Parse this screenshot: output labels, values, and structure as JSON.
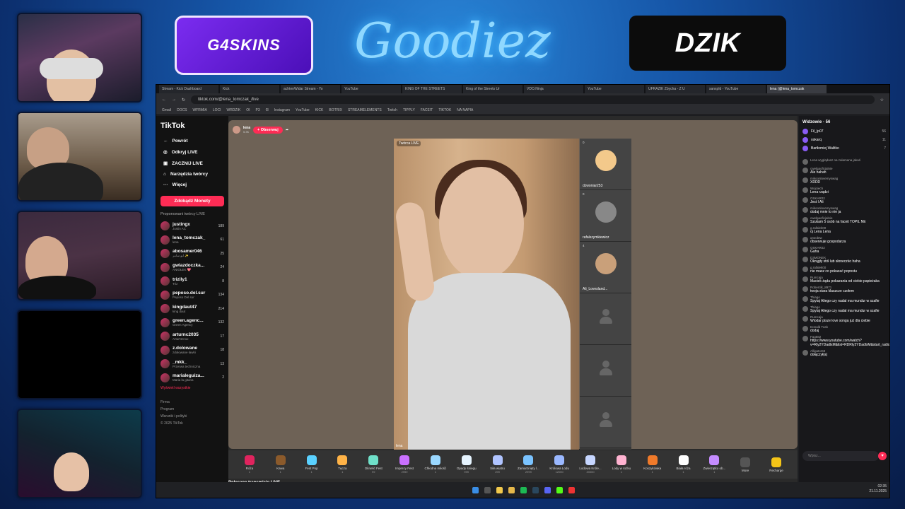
{
  "overlay": {
    "sponsor_left": "G4SKINS",
    "sponsor_center": "Goodiez",
    "sponsor_right": "DZIK"
  },
  "browser": {
    "tabs": [
      "Stream - Kick Dashboard",
      "Kick",
      "achtenWidar Stream - Yo",
      "YouTube",
      "KING OF THE STREETS",
      "King of the Streets Ur",
      "VDO.Ninja",
      "YouTube",
      "UFRAZIK Zbycha - Z U",
      "sanxpld - YouTube",
      "lena (@lena_tomczak"
    ],
    "url": "tiktok.com/@lena_tomczak_/live",
    "bookmarks": [
      "Gmail",
      "DOCS",
      "WFRMIA",
      "LOCI",
      "WRDZIK",
      "OI",
      "P3",
      "f3",
      "Instagram",
      "YouTube",
      "KICK",
      "BOTRIX",
      "STREAMELEMENTS",
      "Twitch",
      "TIPPLY",
      "FACEIT",
      "TIKTOK",
      "NA NAPIA"
    ]
  },
  "tiktok": {
    "logo": "TikTok",
    "nav": [
      {
        "label": "Powrót",
        "icon": "arrow-left-icon"
      },
      {
        "label": "Odkryj LIVE",
        "icon": "compass-icon"
      },
      {
        "label": "ZACZNIJ LIVE",
        "icon": "camera-icon"
      },
      {
        "label": "Narzędzia twórcy",
        "icon": "home-icon"
      },
      {
        "label": "Więcej",
        "icon": "more-icon"
      }
    ],
    "coins_button": "Zdobądź Monety",
    "section_title": "Proponowani twórcy LIVE",
    "creators": [
      {
        "name": "justingx",
        "sub": "Justin AC",
        "viewers": "189"
      },
      {
        "name": "lena_tomczak_",
        "sub": "lena",
        "viewers": "61"
      },
      {
        "name": "abosamer046",
        "sub": "ابو سامر ✨",
        "viewers": "25"
      },
      {
        "name": "gwiazdoczka...",
        "sub": "ANIOŁEK 💖",
        "viewers": "24"
      },
      {
        "name": "trizily1",
        "sub": "Triz",
        "viewers": "8"
      },
      {
        "name": "peposo.del.sur",
        "sub": "Peposo Del sur",
        "viewers": "134"
      },
      {
        "name": "kingdaut47",
        "sub": "king daut",
        "viewers": "214"
      },
      {
        "name": "green.agenc...",
        "sub": "Green Agency",
        "viewers": "132"
      },
      {
        "name": "arturnc2035",
        "sub": "ArturNCrux",
        "viewers": "17"
      },
      {
        "name": "z.dolowane",
        "sub": "zdołowane ławki",
        "viewers": "18"
      },
      {
        "name": "_mkk_",
        "sub": "Przerwa techniczna",
        "viewers": "13"
      },
      {
        "name": "marialeguiza...",
        "sub": "Maria la gitana",
        "viewers": "2"
      }
    ],
    "see_all": "Wyświetl wszystkie",
    "footer": [
      "Firma",
      "Program",
      "Warunki i polityki",
      "© 2025 TikTok"
    ],
    "host": {
      "name": "lena",
      "likes": "5.3K",
      "follow": "+ Obserwuj"
    },
    "video_label": "Twórca LIVE",
    "video_name": "lena",
    "guests": [
      {
        "name": "dzwoniar253",
        "count": "0"
      },
      {
        "name": "rafalszymkiewicz",
        "count": "0"
      },
      {
        "name": "Ali_Lovesland...",
        "count": "4"
      },
      {
        "name": "",
        "count": ""
      },
      {
        "name": "",
        "count": ""
      },
      {
        "name": "",
        "count": ""
      }
    ],
    "gifts": [
      {
        "name": "Róża",
        "cost": "1",
        "color": "#e0245e"
      },
      {
        "name": "Kawa",
        "cost": "1",
        "color": "#8b5a2b"
      },
      {
        "name": "Fest Pop",
        "cost": "1",
        "color": "#5ad1ff"
      },
      {
        "name": "Tęcza",
        "cost": "1",
        "color": "#ffb347"
      },
      {
        "name": "Oknelić Fest",
        "cost": "99",
        "color": "#6fe0c9"
      },
      {
        "name": "Imprezy Fest",
        "cost": "2999",
        "color": "#c970ff"
      },
      {
        "name": "Chłodna miłość",
        "cost": "1",
        "color": "#9ad8ff"
      },
      {
        "name": "Opady śniegu",
        "cost": "999",
        "color": "#e6f4ff"
      },
      {
        "name": "Siła wiatru",
        "cost": "299",
        "color": "#b0c4ff"
      },
      {
        "name": "Zamarznięty l...",
        "cost": "2999",
        "color": "#7ac3ff"
      },
      {
        "name": "Królowa Lodu",
        "cost": "12000",
        "color": "#9ab8ff"
      },
      {
        "name": "Lodowa Króle...",
        "cost": "20000",
        "color": "#c6d6ff"
      },
      {
        "name": "Lody w rożku",
        "cost": "1",
        "color": "#ffb3d1"
      },
      {
        "name": "Koszykówka",
        "cost": "1",
        "color": "#f07a2a"
      },
      {
        "name": "Biała róża",
        "cost": "1",
        "color": "#ffffff"
      },
      {
        "name": "Zwierzątko ob...",
        "cost": "1",
        "color": "#c58cff"
      },
      {
        "name": "More",
        "cost": "",
        "color": "#555555"
      },
      {
        "name": "Recharge",
        "cost": "",
        "color": "#f5c518"
      }
    ],
    "recommend_title": "Polecane transmisje LIVE"
  },
  "chat": {
    "viewers_title": "Widzowie · 56",
    "viewers": [
      {
        "name": "Fil_lp07",
        "score": "56"
      },
      {
        "name": "oskarq",
        "score": "11"
      },
      {
        "name": "Bartłomiej Walitko",
        "score": "7"
      }
    ],
    "messages": [
      {
        "user": "Lena wyglądasz na zalamana jakaś",
        "text": ""
      },
      {
        "user": "cwelgaoficjalnie",
        "text": "Ale hahah"
      },
      {
        "user": "mikoonlovemyswag",
        "text": "XDDD"
      },
      {
        "user": "Wojciech",
        "text": "Lena rządzi"
      },
      {
        "user": "OSKAR02",
        "text": "Jest I Ali"
      },
      {
        "user": "mikoonlovemyswag",
        "text": "dodaj mnie to nie ja"
      },
      {
        "user": "cwelgaoficjalnie",
        "text": "Szukam 5 osób na faceit TOPIL NE"
      },
      {
        "user": "g.rafalek00",
        "text": "oj Lena Lena"
      },
      {
        "user": "qrwobtw",
        "text": "obserwuje gospodarza"
      },
      {
        "user": "OSKAR02",
        "text": "Gaha"
      },
      {
        "user": "D3MONEK",
        "text": "Okrągły stół lub słoneczko haha"
      },
      {
        "user": "g.rafalek00",
        "text": "nie masz co pokazać popnstu"
      },
      {
        "user": "Rumcaja",
        "text": "Maciek żąda pokazania od ciebie papieżaka"
      },
      {
        "user": "Roberclk_8971",
        "text": "twoja stara klaszcze czołem"
      },
      {
        "user": "Thiago",
        "text": "Spytaj Aliego czy nadal ma mundur w szafie"
      },
      {
        "user": "Thiago",
        "text": "Spytaj Aliego czy nadal ma mundur w szafie"
      },
      {
        "user": "Rumcaja",
        "text": "Wiodar pisze love songa już dla ciebie"
      },
      {
        "user": "Donald Tusk",
        "text": "dodaj"
      },
      {
        "user": "Fag582",
        "text": "https://www.youtube.com/watch?v=Rly2YDadlxM&list=RDRly2YDadlxM&start_radio=1"
      },
      {
        "user": "Alligator69",
        "text": "dołączył(a)"
      }
    ],
    "input_placeholder": "Wpisz...",
    "heart": "♥"
  },
  "taskbar": {
    "time": "02:35",
    "date": "21.11.2025"
  }
}
